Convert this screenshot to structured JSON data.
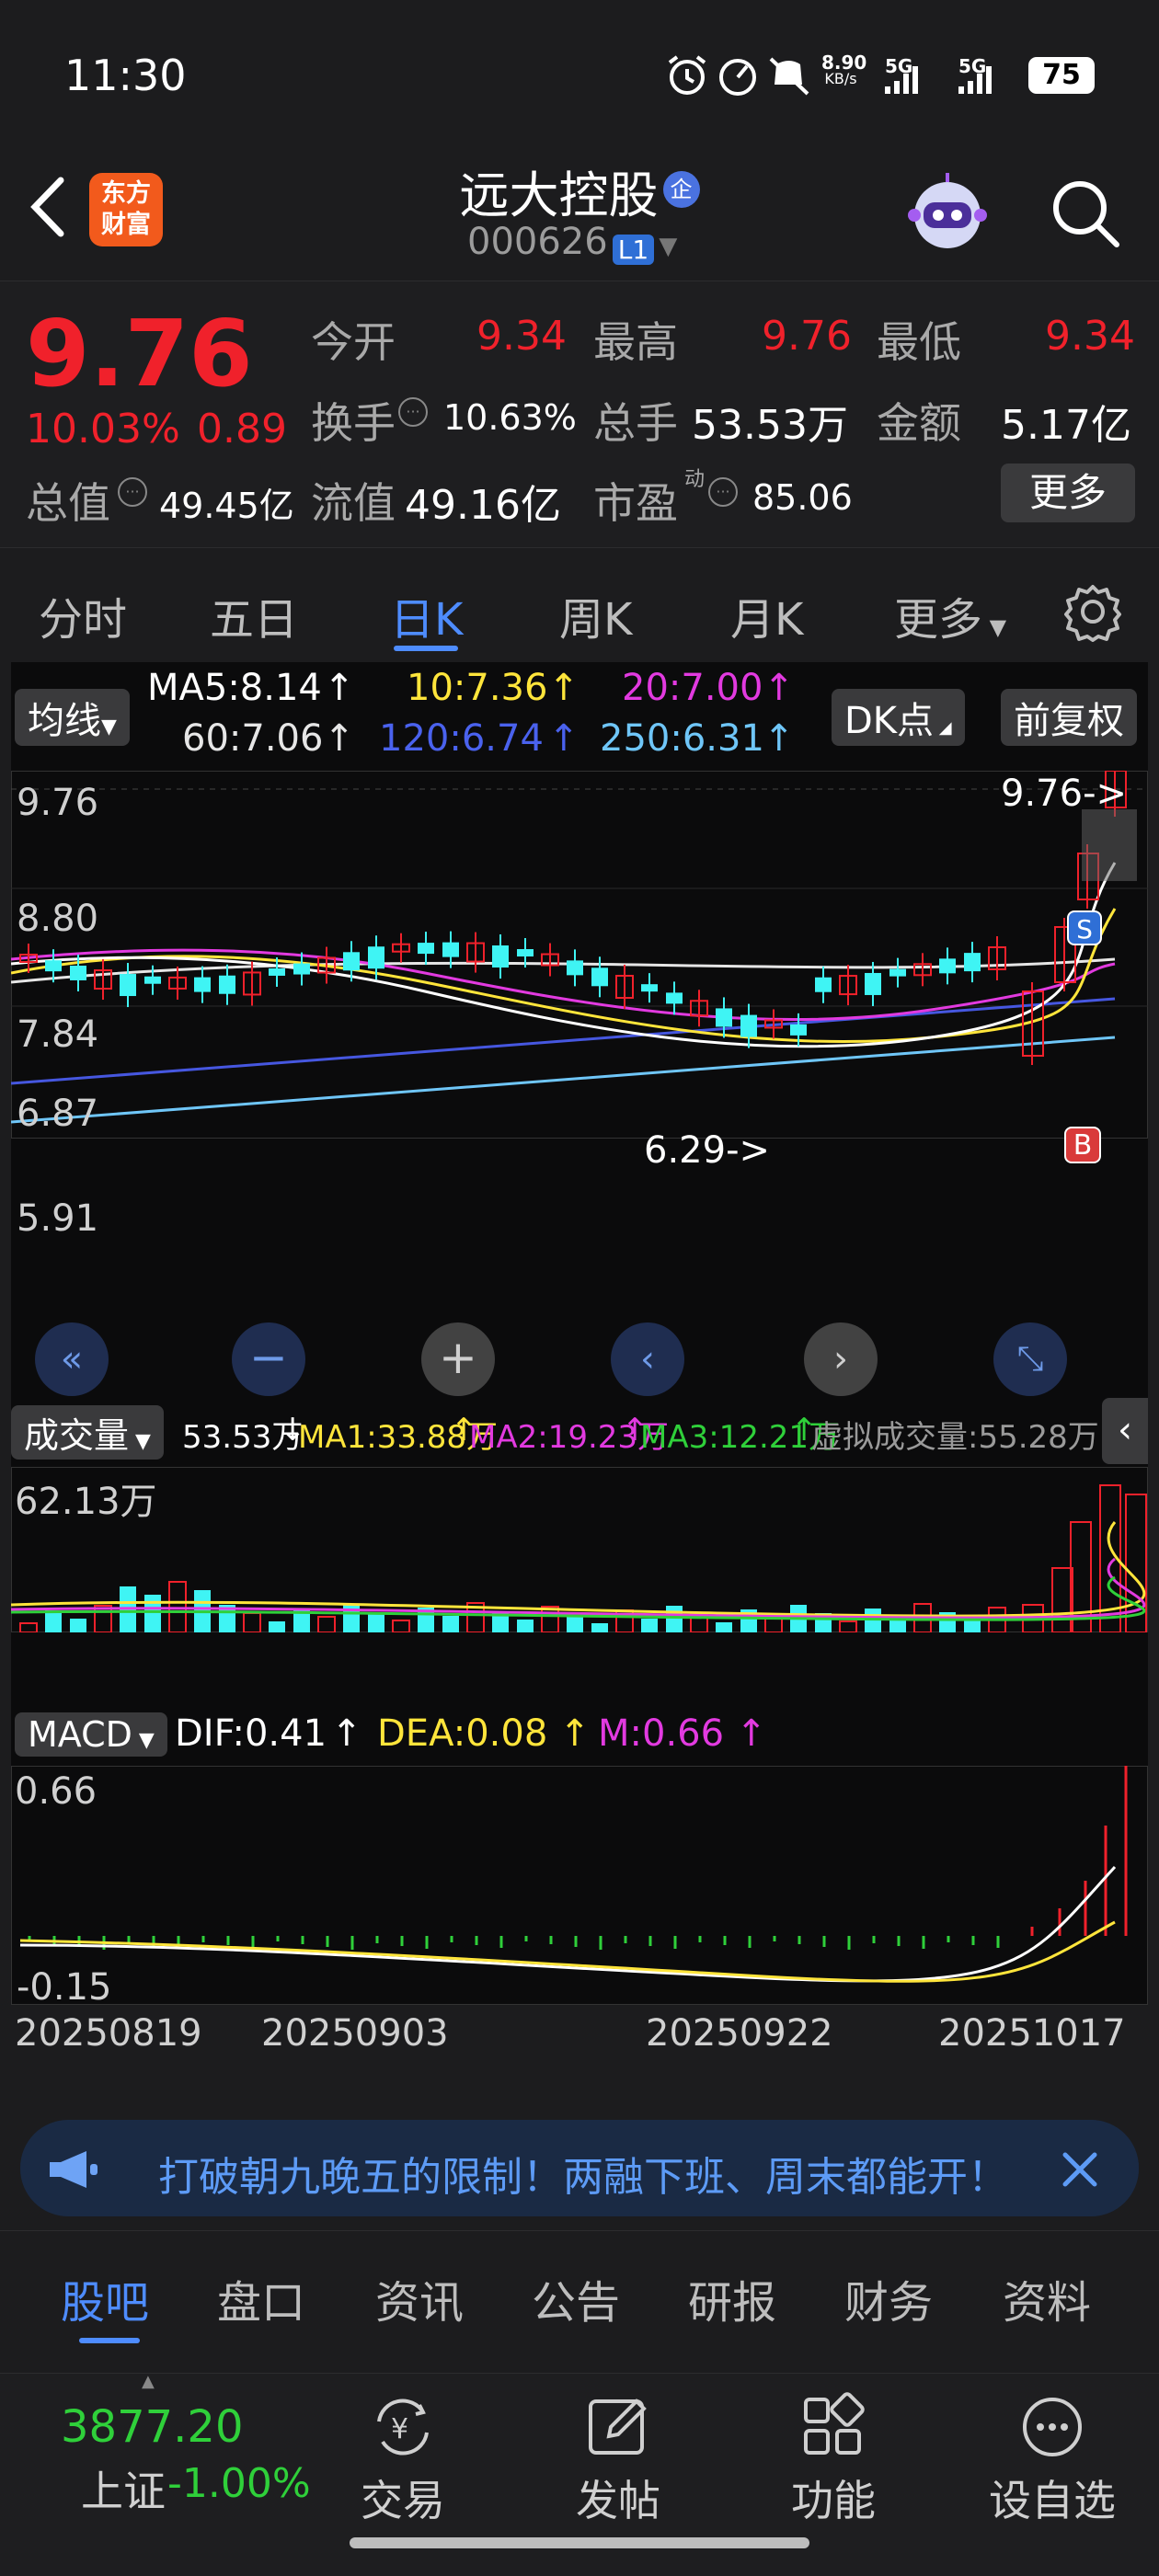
{
  "status": {
    "time": "11:30",
    "speed_value": "8.90",
    "speed_unit": "KB/s",
    "net1": "5G",
    "net2": "5G",
    "battery": "75"
  },
  "header": {
    "brand_line1": "东方",
    "brand_line2": "财富",
    "stock_name": "远大控股",
    "badge": "企",
    "stock_code": "000626",
    "level": "L1"
  },
  "quote": {
    "price": "9.76",
    "change_pct": "10.03%",
    "change_abs": "0.89",
    "open_label": "今开",
    "open_value": "9.34",
    "high_label": "最高",
    "high_value": "9.76",
    "low_label": "最低",
    "low_value": "9.34",
    "turnover_label": "换手",
    "turnover_value": "10.63%",
    "volume_label": "总手",
    "volume_value": "53.53万",
    "amount_label": "金额",
    "amount_value": "5.17亿",
    "mktcap_label": "总值",
    "mktcap_value": "49.45亿",
    "float_label": "流值",
    "float_value": "49.16亿",
    "pe_label": "市盈",
    "pe_sup": "动",
    "pe_value": "85.06",
    "more_label": "更多"
  },
  "period_tabs": [
    "分时",
    "五日",
    "日K",
    "周K",
    "月K",
    "更多"
  ],
  "active_tab_index": 2,
  "ma_legend": {
    "selector": "均线",
    "ma5": "MA5:8.14",
    "ma10": "10:7.36",
    "ma20": "20:7.00",
    "ma60": "60:7.06",
    "ma120": "120:6.74",
    "ma250": "250:6.31",
    "dk_button": "DK点",
    "adjust_button": "前复权"
  },
  "price_chart": {
    "y_labels": [
      "9.76",
      "8.80",
      "7.84",
      "6.87",
      "5.91"
    ],
    "last_label": "9.76->",
    "low_label": "6.29->",
    "buy_marker": "B",
    "sell_marker": "S"
  },
  "volume_legend": {
    "selector": "成交量",
    "vol": "53.53万",
    "ma1": "MA1:33.88万",
    "ma2": "MA2:19.23万",
    "ma3": "MA3:12.21万",
    "virtual": "虚拟成交量:55.28万",
    "max_label": "62.13万"
  },
  "macd_legend": {
    "selector": "MACD",
    "dif": "DIF:0.41",
    "dea": "DEA:0.08",
    "m": "M:0.66",
    "top_label": "0.66",
    "bottom_label": "-0.15"
  },
  "x_dates": [
    "20250819",
    "20250903",
    "20250922",
    "20251017"
  ],
  "banner": {
    "text": "打破朝九晚五的限制！两融下班、周末都能开！"
  },
  "bottom_tabs": [
    "股吧",
    "盘口",
    "资讯",
    "公告",
    "研报",
    "财务",
    "资料"
  ],
  "active_bottom_tab": 0,
  "bottom_nav": {
    "index_value": "3877.20",
    "index_name": "上证",
    "index_change": "-1.00%",
    "items": [
      "交易",
      "发帖",
      "功能",
      "设自选"
    ]
  },
  "colors": {
    "up": "#f0212b",
    "down": "#2fd03a",
    "accent": "#4e8cff",
    "candle_down": "#3ff4f4",
    "ma5": "#ffffff",
    "ma10": "#ffe53b",
    "ma20": "#e23ae0",
    "ma60": "#e6e6e6",
    "ma120": "#4657e0",
    "ma250": "#6fc6f8"
  }
}
